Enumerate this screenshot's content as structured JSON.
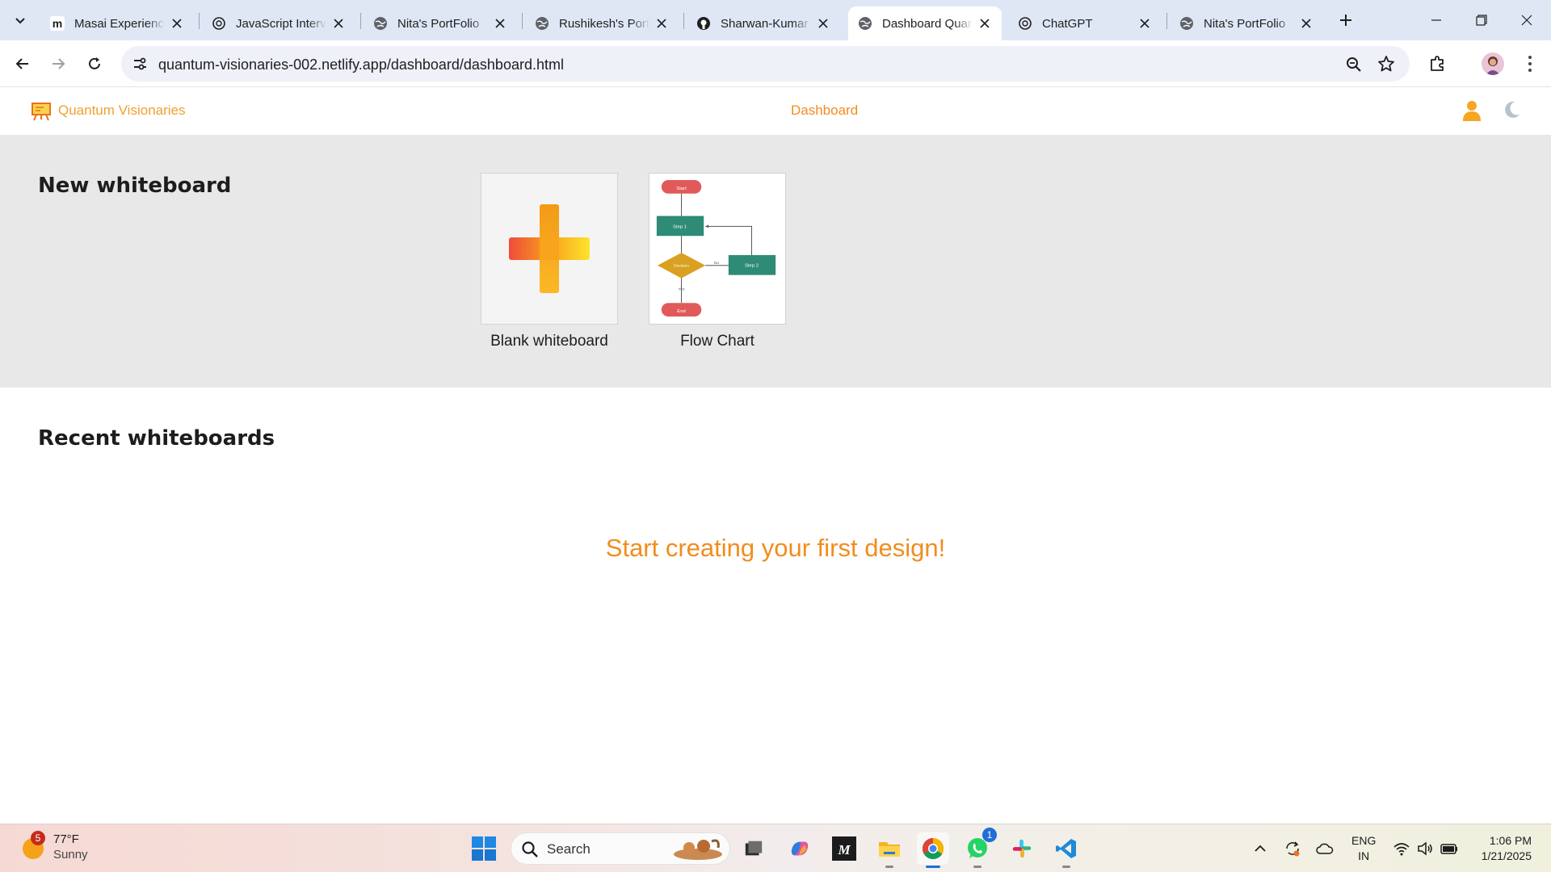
{
  "browser": {
    "tabs": [
      {
        "title": "Masai Experience",
        "favicon": "masai-m-icon"
      },
      {
        "title": "JavaScript Interview",
        "favicon": "openai-icon"
      },
      {
        "title": "Nita's PortFolio",
        "favicon": "globe-icon"
      },
      {
        "title": "Rushikesh's Portfolio",
        "favicon": "globe-icon"
      },
      {
        "title": "Sharwan-Kumar",
        "favicon": "github-icon"
      },
      {
        "title": "Dashboard Quantum",
        "favicon": "globe-icon",
        "active": true
      },
      {
        "title": "ChatGPT",
        "favicon": "openai-icon"
      },
      {
        "title": "Nita's PortFolio",
        "favicon": "globe-icon"
      }
    ],
    "url": "quantum-visionaries-002.netlify.app/dashboard/dashboard.html"
  },
  "site": {
    "brand": "Quantum Visionaries",
    "nav_dashboard": "Dashboard",
    "accent_color": "#f28c1e"
  },
  "new_section": {
    "title": "New whiteboard",
    "templates": [
      {
        "label": "Blank whiteboard",
        "icon": "plus-icon"
      },
      {
        "label": "Flow Chart",
        "icon": "flowchart-thumbnail"
      }
    ],
    "flowchart": {
      "start": "Start",
      "step1": "Step 1",
      "decision": "Decision",
      "no": "No",
      "step2": "Step 2",
      "yes": "Yes",
      "end": "End"
    }
  },
  "recent_section": {
    "title": "Recent whiteboards",
    "empty_message": "Start creating your first design!"
  },
  "taskbar": {
    "weather": {
      "temp": "77°F",
      "condition": "Sunny",
      "badge": "5"
    },
    "search_label": "Search",
    "whatsapp_badge": "1",
    "lang_line1": "ENG",
    "lang_line2": "IN",
    "time": "1:06 PM",
    "date": "1/21/2025"
  }
}
